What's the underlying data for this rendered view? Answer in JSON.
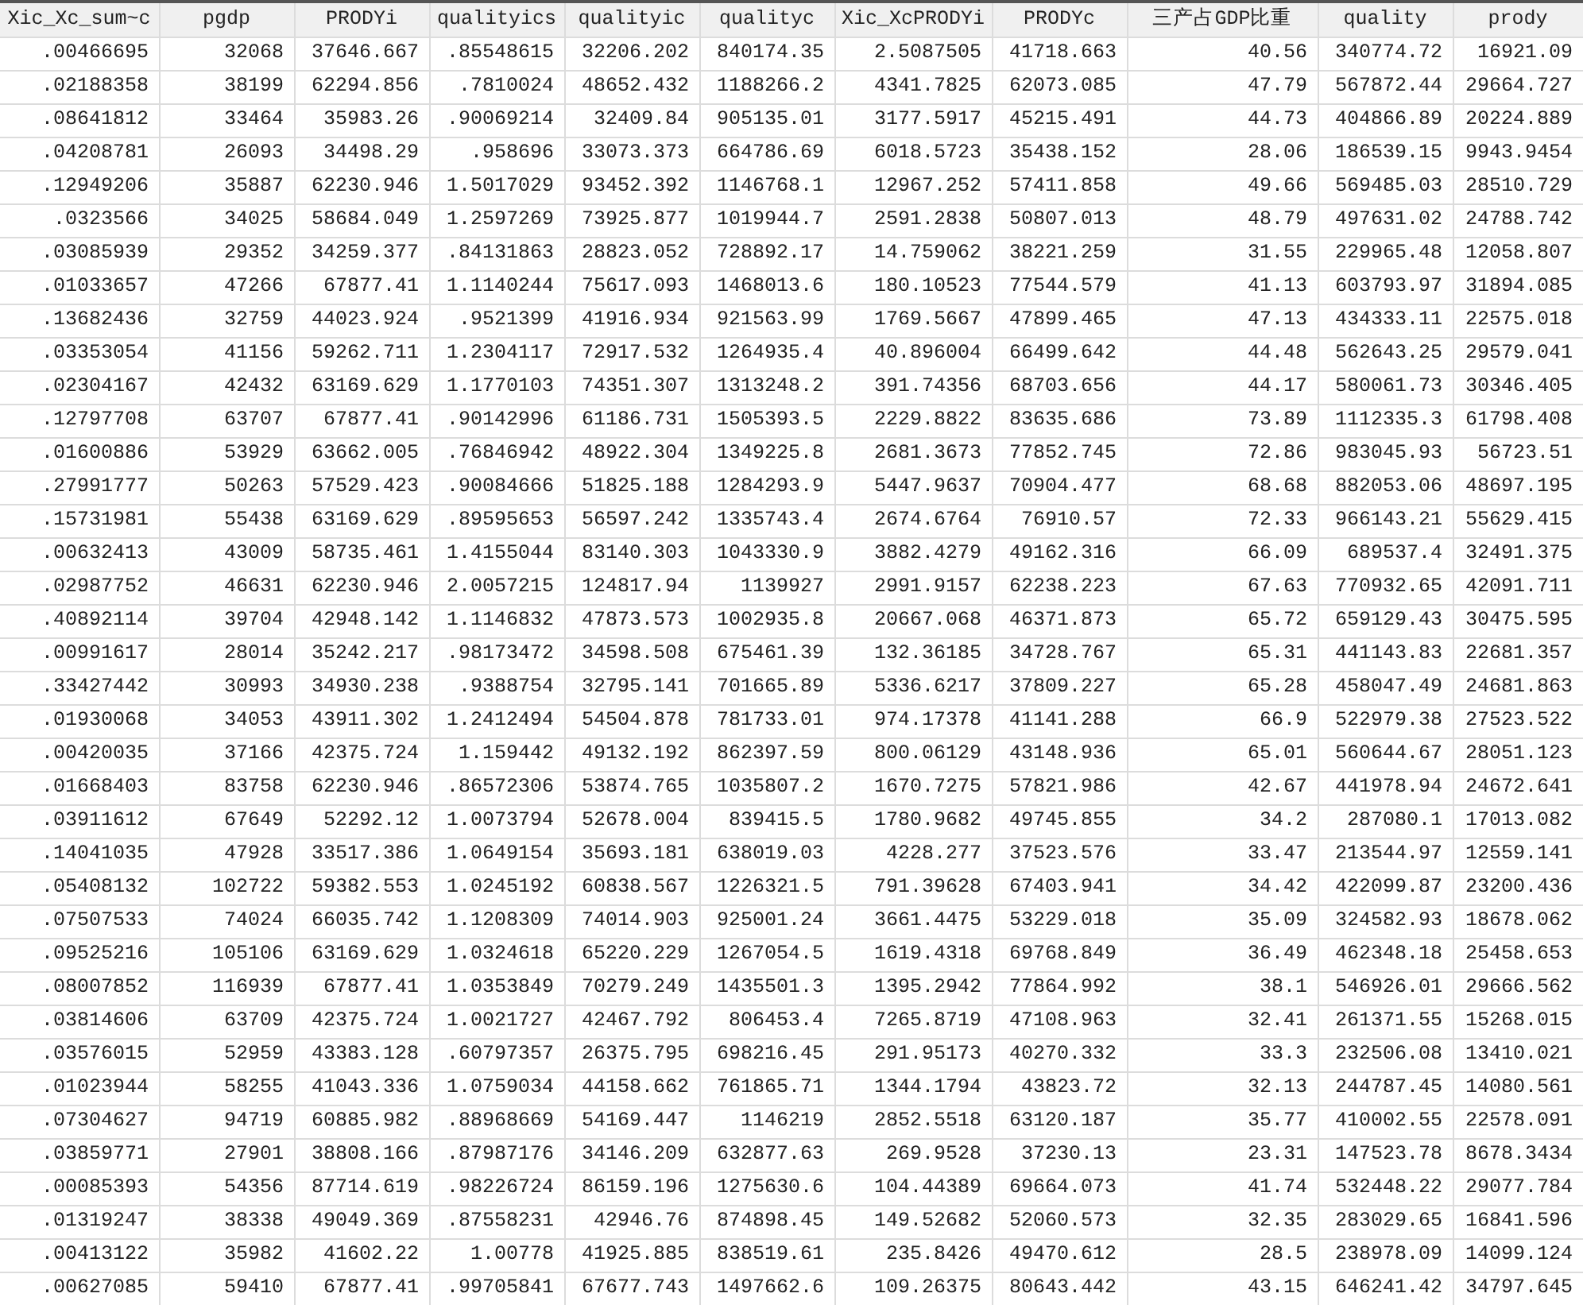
{
  "table": {
    "columns": [
      "Xic_Xc_sum~c",
      "pgdp",
      "PRODYi",
      "qualityics",
      "qualityic",
      "qualityc",
      "Xic_XcPRODYi",
      "PRODYc",
      "三产占GDP比重",
      "quality",
      "prody"
    ],
    "rows": [
      [
        ".00466695",
        "32068",
        "37646.667",
        ".85548615",
        "32206.202",
        "840174.35",
        "2.5087505",
        "41718.663",
        "40.56",
        "340774.72",
        "16921.09"
      ],
      [
        ".02188358",
        "38199",
        "62294.856",
        ".7810024",
        "48652.432",
        "1188266.2",
        "4341.7825",
        "62073.085",
        "47.79",
        "567872.44",
        "29664.727"
      ],
      [
        ".08641812",
        "33464",
        "35983.26",
        ".90069214",
        "32409.84",
        "905135.01",
        "3177.5917",
        "45215.491",
        "44.73",
        "404866.89",
        "20224.889"
      ],
      [
        ".04208781",
        "26093",
        "34498.29",
        ".958696",
        "33073.373",
        "664786.69",
        "6018.5723",
        "35438.152",
        "28.06",
        "186539.15",
        "9943.9454"
      ],
      [
        ".12949206",
        "35887",
        "62230.946",
        "1.5017029",
        "93452.392",
        "1146768.1",
        "12967.252",
        "57411.858",
        "49.66",
        "569485.03",
        "28510.729"
      ],
      [
        ".0323566",
        "34025",
        "58684.049",
        "1.2597269",
        "73925.877",
        "1019944.7",
        "2591.2838",
        "50807.013",
        "48.79",
        "497631.02",
        "24788.742"
      ],
      [
        ".03085939",
        "29352",
        "34259.377",
        ".84131863",
        "28823.052",
        "728892.17",
        "14.759062",
        "38221.259",
        "31.55",
        "229965.48",
        "12058.807"
      ],
      [
        ".01033657",
        "47266",
        "67877.41",
        "1.1140244",
        "75617.093",
        "1468013.6",
        "180.10523",
        "77544.579",
        "41.13",
        "603793.97",
        "31894.085"
      ],
      [
        ".13682436",
        "32759",
        "44023.924",
        ".9521399",
        "41916.934",
        "921563.99",
        "1769.5667",
        "47899.465",
        "47.13",
        "434333.11",
        "22575.018"
      ],
      [
        ".03353054",
        "41156",
        "59262.711",
        "1.2304117",
        "72917.532",
        "1264935.4",
        "40.896004",
        "66499.642",
        "44.48",
        "562643.25",
        "29579.041"
      ],
      [
        ".02304167",
        "42432",
        "63169.629",
        "1.1770103",
        "74351.307",
        "1313248.2",
        "391.74356",
        "68703.656",
        "44.17",
        "580061.73",
        "30346.405"
      ],
      [
        ".12797708",
        "63707",
        "67877.41",
        ".90142996",
        "61186.731",
        "1505393.5",
        "2229.8822",
        "83635.686",
        "73.89",
        "1112335.3",
        "61798.408"
      ],
      [
        ".01600886",
        "53929",
        "63662.005",
        ".76846942",
        "48922.304",
        "1349225.8",
        "2681.3673",
        "77852.745",
        "72.86",
        "983045.93",
        "56723.51"
      ],
      [
        ".27991777",
        "50263",
        "57529.423",
        ".90084666",
        "51825.188",
        "1284293.9",
        "5447.9637",
        "70904.477",
        "68.68",
        "882053.06",
        "48697.195"
      ],
      [
        ".15731981",
        "55438",
        "63169.629",
        ".89595653",
        "56597.242",
        "1335743.4",
        "2674.6764",
        "76910.57",
        "72.33",
        "966143.21",
        "55629.415"
      ],
      [
        ".00632413",
        "43009",
        "58735.461",
        "1.4155044",
        "83140.303",
        "1043330.9",
        "3882.4279",
        "49162.316",
        "66.09",
        "689537.4",
        "32491.375"
      ],
      [
        ".02987752",
        "46631",
        "62230.946",
        "2.0057215",
        "124817.94",
        "1139927",
        "2991.9157",
        "62238.223",
        "67.63",
        "770932.65",
        "42091.711"
      ],
      [
        ".40892114",
        "39704",
        "42948.142",
        "1.1146832",
        "47873.573",
        "1002935.8",
        "20667.068",
        "46371.873",
        "65.72",
        "659129.43",
        "30475.595"
      ],
      [
        ".00991617",
        "28014",
        "35242.217",
        ".98173472",
        "34598.508",
        "675461.39",
        "132.36185",
        "34728.767",
        "65.31",
        "441143.83",
        "22681.357"
      ],
      [
        ".33427442",
        "30993",
        "34930.238",
        ".9388754",
        "32795.141",
        "701665.89",
        "5336.6217",
        "37809.227",
        "65.28",
        "458047.49",
        "24681.863"
      ],
      [
        ".01930068",
        "34053",
        "43911.302",
        "1.2412494",
        "54504.878",
        "781733.01",
        "974.17378",
        "41141.288",
        "66.9",
        "522979.38",
        "27523.522"
      ],
      [
        ".00420035",
        "37166",
        "42375.724",
        "1.159442",
        "49132.192",
        "862397.59",
        "800.06129",
        "43148.936",
        "65.01",
        "560644.67",
        "28051.123"
      ],
      [
        ".01668403",
        "83758",
        "62230.946",
        ".86572306",
        "53874.765",
        "1035807.2",
        "1670.7275",
        "57821.986",
        "42.67",
        "441978.94",
        "24672.641"
      ],
      [
        ".03911612",
        "67649",
        "52292.12",
        "1.0073794",
        "52678.004",
        "839415.5",
        "1780.9682",
        "49745.855",
        "34.2",
        "287080.1",
        "17013.082"
      ],
      [
        ".14041035",
        "47928",
        "33517.386",
        "1.0649154",
        "35693.181",
        "638019.03",
        "4228.277",
        "37523.576",
        "33.47",
        "213544.97",
        "12559.141"
      ],
      [
        ".05408132",
        "102722",
        "59382.553",
        "1.0245192",
        "60838.567",
        "1226321.5",
        "791.39628",
        "67403.941",
        "34.42",
        "422099.87",
        "23200.436"
      ],
      [
        ".07507533",
        "74024",
        "66035.742",
        "1.1208309",
        "74014.903",
        "925001.24",
        "3661.4475",
        "53229.018",
        "35.09",
        "324582.93",
        "18678.062"
      ],
      [
        ".09525216",
        "105106",
        "63169.629",
        "1.0324618",
        "65220.229",
        "1267054.5",
        "1619.4318",
        "69768.849",
        "36.49",
        "462348.18",
        "25458.653"
      ],
      [
        ".08007852",
        "116939",
        "67877.41",
        "1.0353849",
        "70279.249",
        "1435501.3",
        "1395.2942",
        "77864.992",
        "38.1",
        "546926.01",
        "29666.562"
      ],
      [
        ".03814606",
        "63709",
        "42375.724",
        "1.0021727",
        "42467.792",
        "806453.4",
        "7265.8719",
        "47108.963",
        "32.41",
        "261371.55",
        "15268.015"
      ],
      [
        ".03576015",
        "52959",
        "43383.128",
        ".60797357",
        "26375.795",
        "698216.45",
        "291.95173",
        "40270.332",
        "33.3",
        "232506.08",
        "13410.021"
      ],
      [
        ".01023944",
        "58255",
        "41043.336",
        "1.0759034",
        "44158.662",
        "761865.71",
        "1344.1794",
        "43823.72",
        "32.13",
        "244787.45",
        "14080.561"
      ],
      [
        ".07304627",
        "94719",
        "60885.982",
        ".88968669",
        "54169.447",
        "1146219",
        "2852.5518",
        "63120.187",
        "35.77",
        "410002.55",
        "22578.091"
      ],
      [
        ".03859771",
        "27901",
        "38808.166",
        ".87987176",
        "34146.209",
        "632877.63",
        "269.9528",
        "37230.13",
        "23.31",
        "147523.78",
        "8678.3434"
      ],
      [
        ".00085393",
        "54356",
        "87714.619",
        ".98226724",
        "86159.196",
        "1275630.6",
        "104.44389",
        "69664.073",
        "41.74",
        "532448.22",
        "29077.784"
      ],
      [
        ".01319247",
        "38338",
        "49049.369",
        ".87558231",
        "42946.76",
        "874898.45",
        "149.52682",
        "52060.573",
        "32.35",
        "283029.65",
        "16841.596"
      ],
      [
        ".00413122",
        "35982",
        "41602.22",
        "1.00778",
        "41925.885",
        "838519.61",
        "235.8426",
        "49470.612",
        "28.5",
        "238978.09",
        "14099.124"
      ],
      [
        ".00627085",
        "59410",
        "67877.41",
        ".99705841",
        "67677.743",
        "1497662.6",
        "109.26375",
        "80643.442",
        "43.15",
        "646241.42",
        "34797.645"
      ]
    ]
  }
}
